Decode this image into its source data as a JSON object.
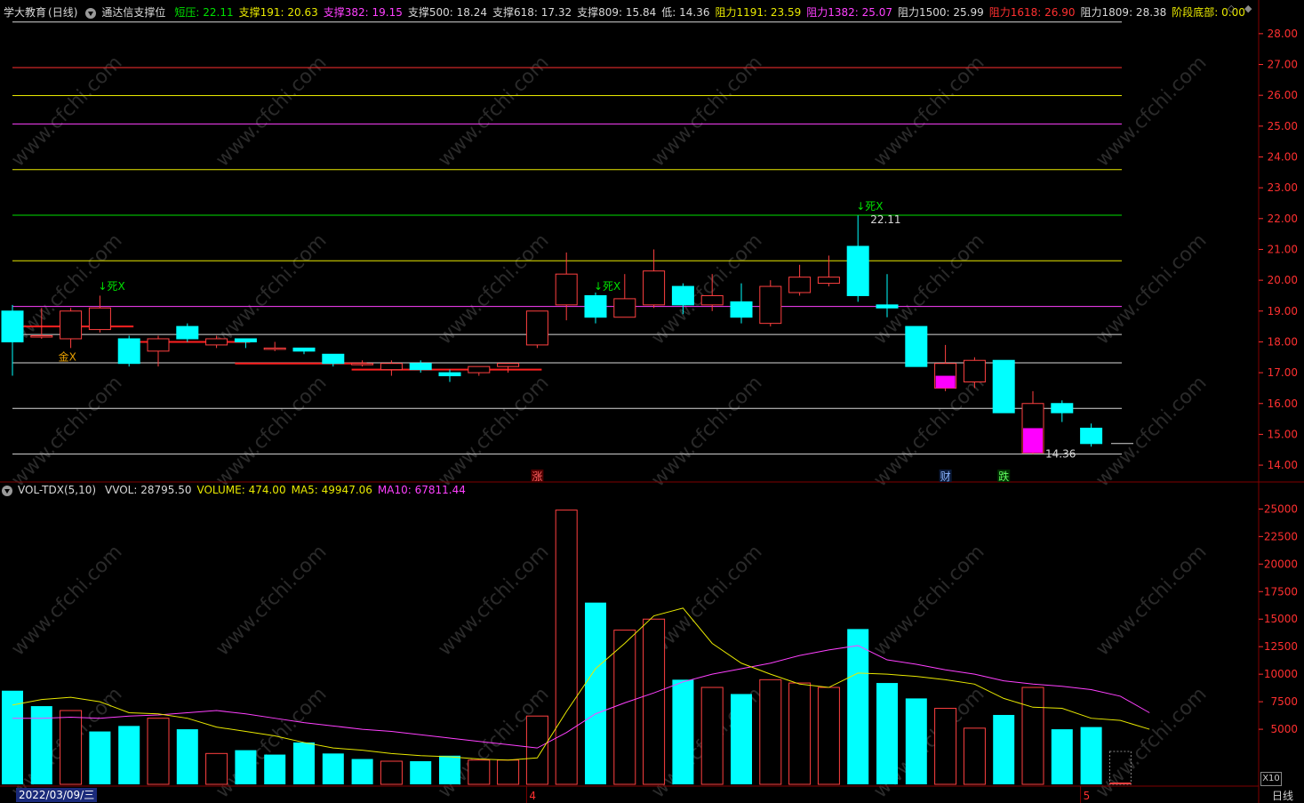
{
  "header": {
    "stock_name": "学大教育",
    "period_label": "(日线)",
    "indicator_name": "通达信支撑位",
    "items": [
      {
        "label": "短压:",
        "value": "22.11",
        "color": "#00e000"
      },
      {
        "label": "支撑191:",
        "value": "20.63",
        "color": "#e8e800"
      },
      {
        "label": "支撑382:",
        "value": "19.15",
        "color": "#ff40ff"
      },
      {
        "label": "支撑500:",
        "value": "18.24",
        "color": "#d8d8d8"
      },
      {
        "label": "支撑618:",
        "value": "17.32",
        "color": "#d8d8d8"
      },
      {
        "label": "支撑809:",
        "value": "15.84",
        "color": "#d8d8d8"
      },
      {
        "label": "低:",
        "value": "14.36",
        "color": "#d8d8d8"
      },
      {
        "label": "阻力1191:",
        "value": "23.59",
        "color": "#e8e800"
      },
      {
        "label": "阻力1382:",
        "value": "25.07",
        "color": "#ff40ff"
      },
      {
        "label": "阻力1500:",
        "value": "25.99",
        "color": "#d8d8d8"
      },
      {
        "label": "阻力1618:",
        "value": "26.90",
        "color": "#ff3030"
      },
      {
        "label": "阻力1809:",
        "value": "28.38",
        "color": "#d8d8d8"
      },
      {
        "label": "阶段底部:",
        "value": "0.00",
        "color": "#e8e800"
      }
    ]
  },
  "volume_header": {
    "name": "VOL-TDX(5,10)",
    "items": [
      {
        "label": "VVOL:",
        "value": "28795.50",
        "color": "#d8d8d8"
      },
      {
        "label": "VOLUME:",
        "value": "474.00",
        "color": "#e8e800"
      },
      {
        "label": "MA5:",
        "value": "49947.06",
        "color": "#e8e800"
      },
      {
        "label": "MA10:",
        "value": "67811.44",
        "color": "#ff40ff"
      }
    ]
  },
  "footer": {
    "date_label": "2022/03/09/三",
    "month_labels": [
      {
        "text": "4",
        "index": 18
      },
      {
        "text": "5",
        "index": 37
      }
    ],
    "period": "日线",
    "scale_tag": "X10"
  },
  "watermark": "www.cfchi.com",
  "colors": {
    "up": "#ff4040",
    "down": "#00ffff",
    "ma5": "#e8e800",
    "ma10": "#ff40ff",
    "grid": "#800000",
    "axis_text": "#ff3030"
  },
  "chart_data": [
    {
      "type": "candlestick",
      "title": "学大教育 (日线)",
      "ylim": [
        13.8,
        28.4
      ],
      "y_ticks": [
        14,
        15,
        16,
        17,
        18,
        19,
        20,
        21,
        22,
        23,
        24,
        25,
        26,
        27,
        28
      ],
      "y_tick_labels": [
        "14.00",
        "15.00",
        "16.00",
        "17.00",
        "18.00",
        "19.00",
        "20.00",
        "21.00",
        "22.00",
        "23.00",
        "24.00",
        "25.00",
        "26.00",
        "27.00",
        "28.00"
      ],
      "candles": [
        {
          "o": 19.0,
          "h": 19.2,
          "l": 16.9,
          "c": 18.0
        },
        {
          "o": 18.2,
          "h": 19.1,
          "l": 18.1,
          "c": 18.2
        },
        {
          "o": 18.1,
          "h": 19.1,
          "l": 17.8,
          "c": 19.0
        },
        {
          "o": 18.4,
          "h": 19.5,
          "l": 18.3,
          "c": 19.1
        },
        {
          "o": 18.1,
          "h": 18.2,
          "l": 17.2,
          "c": 17.3
        },
        {
          "o": 17.7,
          "h": 18.2,
          "l": 17.2,
          "c": 18.1
        },
        {
          "o": 18.5,
          "h": 18.6,
          "l": 18.0,
          "c": 18.1
        },
        {
          "o": 17.9,
          "h": 18.2,
          "l": 17.8,
          "c": 18.1
        },
        {
          "o": 18.1,
          "h": 18.1,
          "l": 17.8,
          "c": 18.0
        },
        {
          "o": 17.8,
          "h": 18.0,
          "l": 17.7,
          "c": 17.8
        },
        {
          "o": 17.8,
          "h": 17.8,
          "l": 17.6,
          "c": 17.7
        },
        {
          "o": 17.6,
          "h": 17.6,
          "l": 17.2,
          "c": 17.3
        },
        {
          "o": 17.3,
          "h": 17.4,
          "l": 17.2,
          "c": 17.3
        },
        {
          "o": 17.1,
          "h": 17.4,
          "l": 16.9,
          "c": 17.3
        },
        {
          "o": 17.3,
          "h": 17.4,
          "l": 17.0,
          "c": 17.1
        },
        {
          "o": 17.0,
          "h": 17.1,
          "l": 16.7,
          "c": 16.9
        },
        {
          "o": 17.0,
          "h": 17.2,
          "l": 16.9,
          "c": 17.2
        },
        {
          "o": 17.2,
          "h": 17.3,
          "l": 17.0,
          "c": 17.3
        },
        {
          "o": 17.9,
          "h": 19.0,
          "l": 17.8,
          "c": 19.0
        },
        {
          "o": 19.2,
          "h": 20.9,
          "l": 18.7,
          "c": 20.2
        },
        {
          "o": 19.5,
          "h": 19.6,
          "l": 18.6,
          "c": 18.8
        },
        {
          "o": 18.8,
          "h": 20.2,
          "l": 18.8,
          "c": 19.4
        },
        {
          "o": 19.2,
          "h": 21.0,
          "l": 19.1,
          "c": 20.3
        },
        {
          "o": 19.8,
          "h": 19.9,
          "l": 18.9,
          "c": 19.2
        },
        {
          "o": 19.2,
          "h": 20.2,
          "l": 19.0,
          "c": 19.5
        },
        {
          "o": 19.3,
          "h": 19.9,
          "l": 18.6,
          "c": 18.8
        },
        {
          "o": 18.6,
          "h": 20.0,
          "l": 18.5,
          "c": 19.8
        },
        {
          "o": 19.6,
          "h": 20.5,
          "l": 19.5,
          "c": 20.1
        },
        {
          "o": 19.9,
          "h": 20.8,
          "l": 19.8,
          "c": 20.1
        },
        {
          "o": 21.1,
          "h": 22.1,
          "l": 19.3,
          "c": 19.5
        },
        {
          "o": 19.2,
          "h": 20.2,
          "l": 18.8,
          "c": 19.1
        },
        {
          "o": 18.5,
          "h": 18.5,
          "l": 17.2,
          "c": 17.2
        },
        {
          "o": 16.5,
          "h": 17.9,
          "l": 16.4,
          "c": 17.3
        },
        {
          "o": 16.7,
          "h": 17.5,
          "l": 16.5,
          "c": 17.4
        },
        {
          "o": 17.4,
          "h": 17.4,
          "l": 15.7,
          "c": 15.7
        },
        {
          "o": 14.4,
          "h": 16.4,
          "l": 14.36,
          "c": 16.0
        },
        {
          "o": 16.0,
          "h": 16.1,
          "l": 15.4,
          "c": 15.7
        },
        {
          "o": 15.2,
          "h": 15.35,
          "l": 14.6,
          "c": 14.7
        }
      ],
      "volume_surge_fills": [
        {
          "index": 32,
          "from": 16.5,
          "to": 16.9,
          "color": "#ff00ff"
        },
        {
          "index": 35,
          "from": 14.4,
          "to": 15.2,
          "color": "#ff00ff"
        }
      ],
      "support_lines": [
        {
          "value": 28.38,
          "color": "#d8d8d8"
        },
        {
          "value": 26.9,
          "color": "#ff3030"
        },
        {
          "value": 25.99,
          "color": "#e8e800"
        },
        {
          "value": 25.07,
          "color": "#ff40ff"
        },
        {
          "value": 23.59,
          "color": "#e8e800"
        },
        {
          "value": 22.11,
          "color": "#00e000"
        },
        {
          "value": 20.63,
          "color": "#e8e800"
        },
        {
          "value": 19.15,
          "color": "#ff40ff"
        },
        {
          "value": 18.24,
          "color": "#d8d8d8"
        },
        {
          "value": 17.32,
          "color": "#d8d8d8"
        },
        {
          "value": 15.84,
          "color": "#d8d8d8"
        },
        {
          "value": 14.36,
          "color": "#d8d8d8"
        }
      ],
      "segments": [
        {
          "from": 0,
          "to": 4,
          "value": 18.5,
          "color": "#ff2020"
        },
        {
          "from": 4,
          "to": 8,
          "value": 18.0,
          "color": "#ff2020"
        },
        {
          "from": 8,
          "to": 12,
          "value": 17.3,
          "color": "#ff2020"
        },
        {
          "from": 12,
          "to": 18,
          "value": 17.1,
          "color": "#ff2020"
        }
      ],
      "annotations": [
        {
          "text": "↓死X",
          "index": 3,
          "value": 19.6,
          "color": "#00e000"
        },
        {
          "text": "金X",
          "index": 2,
          "value": 17.3,
          "color": "#e8a000"
        },
        {
          "text": "↓死X",
          "index": 20,
          "value": 19.6,
          "color": "#00e000"
        },
        {
          "text": "↓死X",
          "index": 29,
          "value": 22.2,
          "color": "#00e000"
        },
        {
          "text": "22.11",
          "index": 29,
          "value": 22.11,
          "color": "#d8d8d8"
        },
        {
          "text": "14.36",
          "index": 35,
          "value": 14.36,
          "color": "#d8d8d8"
        }
      ],
      "event_markers": [
        {
          "text": "涨",
          "index": 18,
          "color": "#ff6060",
          "bg": "#500000"
        },
        {
          "text": "财",
          "index": 32,
          "color": "#8ab4ff",
          "bg": "#0a1a3a"
        },
        {
          "text": "跌",
          "index": 34,
          "color": "#60ff60",
          "bg": "#003000"
        }
      ]
    },
    {
      "type": "bar",
      "title": "VOL-TDX(5,10)",
      "ylim": [
        0,
        26000
      ],
      "y_ticks": [
        5000,
        7500,
        10000,
        12500,
        15000,
        17500,
        20000,
        22500,
        25000
      ],
      "y_tick_labels": [
        "5000",
        "7500",
        "10000",
        "12500",
        "15000",
        "17500",
        "20000",
        "22500",
        "25000"
      ],
      "volumes": [
        8500,
        7100,
        6700,
        4800,
        5300,
        6000,
        5000,
        2800,
        3100,
        2700,
        3800,
        2800,
        2300,
        2100,
        2100,
        2600,
        2200,
        2200,
        6200,
        24900,
        16500,
        14000,
        15000,
        9500,
        8800,
        8200,
        9500,
        9200,
        8800,
        14100,
        9200,
        7800,
        6900,
        5100,
        6300,
        8800,
        5000,
        5200
      ],
      "up_flags": [
        false,
        false,
        true,
        false,
        false,
        true,
        false,
        true,
        false,
        false,
        false,
        false,
        false,
        true,
        false,
        false,
        true,
        true,
        true,
        true,
        false,
        true,
        true,
        false,
        true,
        false,
        true,
        true,
        true,
        false,
        false,
        false,
        true,
        true,
        false,
        true,
        false,
        false
      ],
      "ma5": [
        7200,
        7700,
        7900,
        7500,
        6500,
        6400,
        6000,
        5200,
        4800,
        4400,
        3800,
        3300,
        3100,
        2800,
        2600,
        2500,
        2300,
        2200,
        2400,
        6600,
        10500,
        12800,
        15300,
        16000,
        12800,
        11000,
        10000,
        9100,
        8800,
        10100,
        10000,
        9800,
        9500,
        9100,
        7800,
        7000,
        6900,
        6000,
        5800,
        5000
      ],
      "ma10": [
        6000,
        6000,
        6100,
        6000,
        6200,
        6300,
        6500,
        6700,
        6400,
        6000,
        5600,
        5300,
        5000,
        4800,
        4500,
        4200,
        3900,
        3600,
        3300,
        4700,
        6400,
        7400,
        8300,
        9300,
        10000,
        10500,
        11000,
        11700,
        12200,
        12600,
        11300,
        10900,
        10400,
        10000,
        9400,
        9100,
        8900,
        8600,
        8000,
        6500
      ],
      "final_volume": 474,
      "legend": [
        "VVOL",
        "VOLUME",
        "MA5",
        "MA10"
      ]
    }
  ]
}
